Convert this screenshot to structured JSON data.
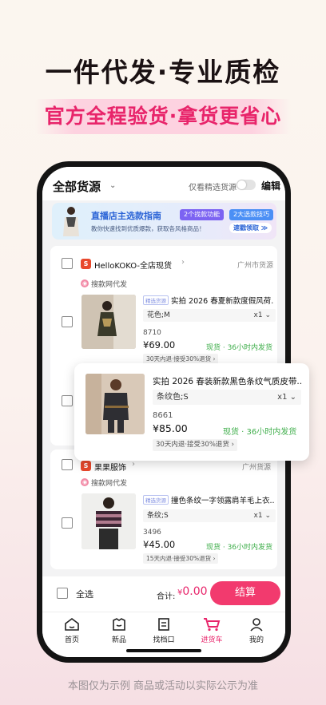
{
  "headline": "一件代发·专业质检",
  "subline": "官方全程验货·拿货更省心",
  "footer_note": "本图仅为示例 商品或活动以实际公示为准",
  "topbar": {
    "title": "全部货源",
    "toggle_label": "仅看精选货源",
    "edit_label": "编辑"
  },
  "banner": {
    "title": "直播店主选款指南",
    "chip1": "2个找款功能",
    "chip2": "2大选款技巧",
    "subtitle": "教你快速找到优质爆款，获取各风格商品！",
    "button": "速戳领取 ≫"
  },
  "shops": [
    {
      "icon": "S",
      "name": "HelloKOKO-全店现货",
      "location": "广州市货源",
      "source": "搜款网代发",
      "item": {
        "tag": "精选货源",
        "title": "实拍 2026 春夏新款度假风荷...",
        "spec": "花色;M",
        "qty": "x1",
        "sku": "8710",
        "price": "¥69.00",
        "ship": "现货 · 36小时内发货",
        "returns": "30天内退·接受30%退货 ›"
      }
    },
    {
      "icon": "S",
      "name": "果果服饰",
      "location": "广州货源",
      "source": "搜款网代发",
      "item": {
        "tag": "精选货源",
        "title": "撞色条纹一字领露肩羊毛上衣...",
        "spec": "条纹;S",
        "qty": "x1",
        "sku": "3496",
        "price": "¥45.00",
        "ship": "现货 · 36小时内发货",
        "returns": "15天内退·接受30%退货 ›"
      }
    }
  ],
  "popup": {
    "title": "实拍 2026 春装新款黑色条纹气质皮带...",
    "spec": "条纹色;S",
    "qty": "x1",
    "sku": "8661",
    "price": "¥85.00",
    "ship": "现货 · 36小时内发货",
    "returns": "30天内退·接受30%退货 ›"
  },
  "checkout": {
    "select_all": "全选",
    "total_label": "合计:",
    "total_currency": "¥",
    "total_value": "0.00",
    "pay_button": "结算"
  },
  "tabs": [
    {
      "label": "首页",
      "icon": "home-icon"
    },
    {
      "label": "新品",
      "icon": "new-icon"
    },
    {
      "label": "找档口",
      "icon": "store-icon"
    },
    {
      "label": "进货车",
      "icon": "cart-icon"
    },
    {
      "label": "我的",
      "icon": "profile-icon"
    }
  ],
  "colors": {
    "accent": "#e8246a",
    "pay": "#f23a6e",
    "ship": "#3fae4b",
    "banner_text": "#2a63d6"
  }
}
